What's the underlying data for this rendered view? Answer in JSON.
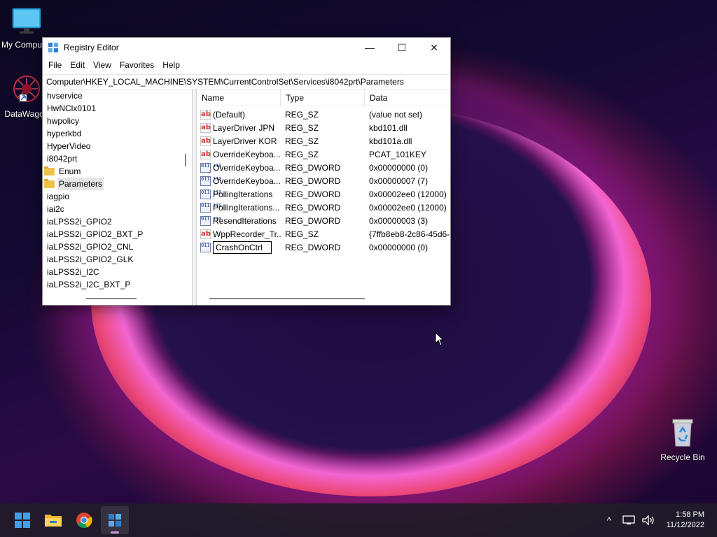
{
  "desktop": {
    "icons": [
      {
        "label": "My Computer",
        "icon": "monitor-icon"
      },
      {
        "label": "DataWagon",
        "icon": "datawagon-app-icon"
      },
      {
        "label": "Recycle Bin",
        "icon": "recycle-bin-icon"
      }
    ]
  },
  "window": {
    "title": "Registry Editor",
    "controls": {
      "minimize": "—",
      "maximize": "☐",
      "close": "✕"
    },
    "menu": [
      "File",
      "Edit",
      "View",
      "Favorites",
      "Help"
    ],
    "address": "Computer\\HKEY_LOCAL_MACHINE\\SYSTEM\\CurrentControlSet\\Services\\i8042prt\\Parameters",
    "tree": [
      {
        "label": "hvservice",
        "folder": false,
        "selected": false
      },
      {
        "label": "HwNClx0101",
        "folder": false,
        "selected": false
      },
      {
        "label": "hwpolicy",
        "folder": false,
        "selected": false
      },
      {
        "label": "hyperkbd",
        "folder": false,
        "selected": false
      },
      {
        "label": "HyperVideo",
        "folder": false,
        "selected": false
      },
      {
        "label": "i8042prt",
        "folder": false,
        "selected": false
      },
      {
        "label": "Enum",
        "folder": true,
        "selected": false
      },
      {
        "label": "Parameters",
        "folder": true,
        "selected": true
      },
      {
        "label": "iagpio",
        "folder": false,
        "selected": false
      },
      {
        "label": "iai2c",
        "folder": false,
        "selected": false
      },
      {
        "label": "iaLPSS2i_GPIO2",
        "folder": false,
        "selected": false
      },
      {
        "label": "iaLPSS2i_GPIO2_BXT_P",
        "folder": false,
        "selected": false
      },
      {
        "label": "iaLPSS2i_GPIO2_CNL",
        "folder": false,
        "selected": false
      },
      {
        "label": "iaLPSS2i_GPIO2_GLK",
        "folder": false,
        "selected": false
      },
      {
        "label": "iaLPSS2i_I2C",
        "folder": false,
        "selected": false
      },
      {
        "label": "iaLPSS2i_I2C_BXT_P",
        "folder": false,
        "selected": false
      }
    ],
    "columns": {
      "name": "Name",
      "type": "Type",
      "data": "Data"
    },
    "values": [
      {
        "name": "(Default)",
        "type": "REG_SZ",
        "data": "(value not set)",
        "kind": "string"
      },
      {
        "name": "LayerDriver JPN",
        "type": "REG_SZ",
        "data": "kbd101.dll",
        "kind": "string"
      },
      {
        "name": "LayerDriver KOR",
        "type": "REG_SZ",
        "data": "kbd101a.dll",
        "kind": "string"
      },
      {
        "name": "OverrideKeyboa...",
        "type": "REG_SZ",
        "data": "PCAT_101KEY",
        "kind": "string"
      },
      {
        "name": "OverrideKeyboa...",
        "type": "REG_DWORD",
        "data": "0x00000000 (0)",
        "kind": "binary"
      },
      {
        "name": "OverrideKeyboa...",
        "type": "REG_DWORD",
        "data": "0x00000007 (7)",
        "kind": "binary"
      },
      {
        "name": "PollingIterations",
        "type": "REG_DWORD",
        "data": "0x00002ee0 (12000)",
        "kind": "binary"
      },
      {
        "name": "PollingIterations...",
        "type": "REG_DWORD",
        "data": "0x00002ee0 (12000)",
        "kind": "binary"
      },
      {
        "name": "ResendIterations",
        "type": "REG_DWORD",
        "data": "0x00000003 (3)",
        "kind": "binary"
      },
      {
        "name": "WppRecorder_Tr...",
        "type": "REG_SZ",
        "data": "{7ffb8eb8-2c86-45d6-",
        "kind": "string"
      },
      {
        "name": "CrashOnCtrl",
        "type": "REG_DWORD",
        "data": "0x00000000 (0)",
        "kind": "binary",
        "editing": true
      }
    ]
  },
  "taskbar": {
    "apps": [
      "start-icon",
      "file-explorer-icon",
      "chrome-icon",
      "registry-editor-icon"
    ],
    "tray": {
      "chevron": "^",
      "clock_time": "1:58 PM",
      "clock_date": "11/12/2022"
    }
  }
}
